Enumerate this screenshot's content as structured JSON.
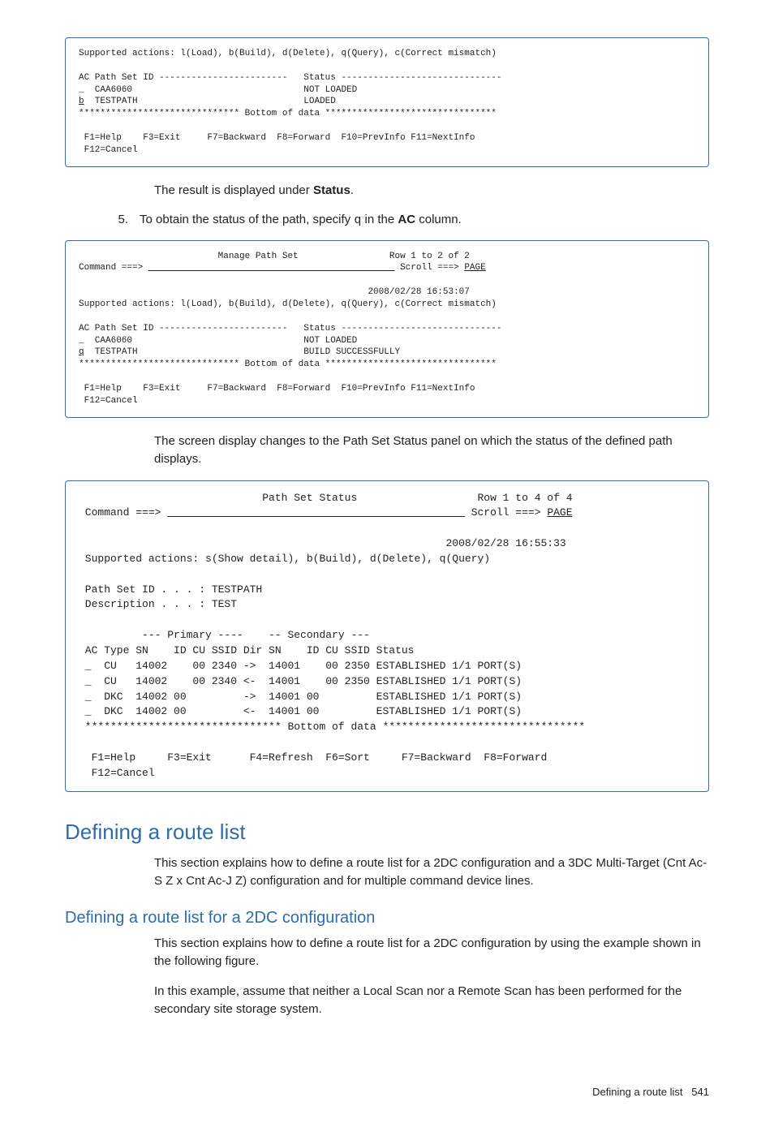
{
  "terminal1": {
    "supported": "Supported actions: l(Load), b(Build), d(Delete), q(Query), c(Correct mismatch)",
    "hdr": "AC Path Set ID ------------------------   Status ------------------------------",
    "row1": "_  CAA6060                                NOT LOADED",
    "row2_prefix": "b",
    "row2_rest": "  TESTPATH                               LOADED",
    "bottom": "****************************** Bottom of data ********************************",
    "fkeys": " F1=Help    F3=Exit     F7=Backward  F8=Forward  F10=PrevInfo F11=NextInfo\n F12=Cancel"
  },
  "para1_before": "The result is displayed under ",
  "para1_bold": "Status",
  "para1_after": ".",
  "step5_num": "5.",
  "step5_before": "To obtain the status of the path, specify ",
  "step5_code": "q",
  "step5_middle": " in the ",
  "step5_bold": "AC",
  "step5_after": " column.",
  "terminal2": {
    "title_line": "                          Manage Path Set                 Row 1 to 2 of 2",
    "cmd_line_pre": "Command ===> ",
    "cmd_blank": "                                              ",
    "scroll": " Scroll ===> ",
    "scroll_val": "PAGE",
    "ts": "                                                      2008/02/28 16:53:07",
    "supported": "Supported actions: l(Load), b(Build), d(Delete), q(Query), c(Correct mismatch)",
    "hdr": "AC Path Set ID ------------------------   Status ------------------------------",
    "row1": "_  CAA6060                                NOT LOADED",
    "row2_prefix": "q",
    "row2_rest": "  TESTPATH                               BUILD SUCCESSFULLY",
    "bottom": "****************************** Bottom of data ********************************",
    "fkeys": " F1=Help    F3=Exit     F7=Backward  F8=Forward  F10=PrevInfo F11=NextInfo\n F12=Cancel"
  },
  "para2": "The screen display changes to the Path Set Status panel on which the status of the defined path displays.",
  "terminal3": {
    "title_line": "                             Path Set Status                   Row 1 to 4 of 4",
    "cmd_line_pre": " Command ===> ",
    "cmd_blank": "                                               ",
    "scroll": " Scroll ===> ",
    "scroll_val": "PAGE",
    "ts": "                                                          2008/02/28 16:55:33",
    "supported": " Supported actions: s(Show detail), b(Build), d(Delete), q(Query)",
    "pathset": " Path Set ID . . . : TESTPATH",
    "descr": " Description . . . : TEST",
    "colhdr1": "          --- Primary ----    -- Secondary ---",
    "colhdr2": " AC Type SN    ID CU SSID Dir SN    ID CU SSID Status",
    "r1": " _  CU   14002    00 2340 ->  14001    00 2350 ESTABLISHED 1/1 PORT(S)",
    "r2": " _  CU   14002    00 2340 <-  14001    00 2350 ESTABLISHED 1/1 PORT(S)",
    "r3": " _  DKC  14002 00         ->  14001 00         ESTABLISHED 1/1 PORT(S)",
    "r4": " _  DKC  14002 00         <-  14001 00         ESTABLISHED 1/1 PORT(S)",
    "bottom": " ******************************* Bottom of data ********************************",
    "fkeys": "  F1=Help     F3=Exit      F4=Refresh  F6=Sort     F7=Backward  F8=Forward\n  F12=Cancel"
  },
  "h1": "Defining a route list",
  "para3": "This section explains how to define a route list for a 2DC configuration and a 3DC Multi-Target (Cnt Ac-S Z x Cnt Ac-J Z) configuration and for multiple command device lines.",
  "h2": "Defining a route list for a 2DC configuration",
  "para4": "This section explains how to define a route list for a 2DC configuration by using the example shown in the following figure.",
  "para5": "In this example, assume that neither a Local Scan nor a Remote Scan has been performed for the secondary site storage system.",
  "footer_label": "Defining a route list",
  "footer_page": "541"
}
